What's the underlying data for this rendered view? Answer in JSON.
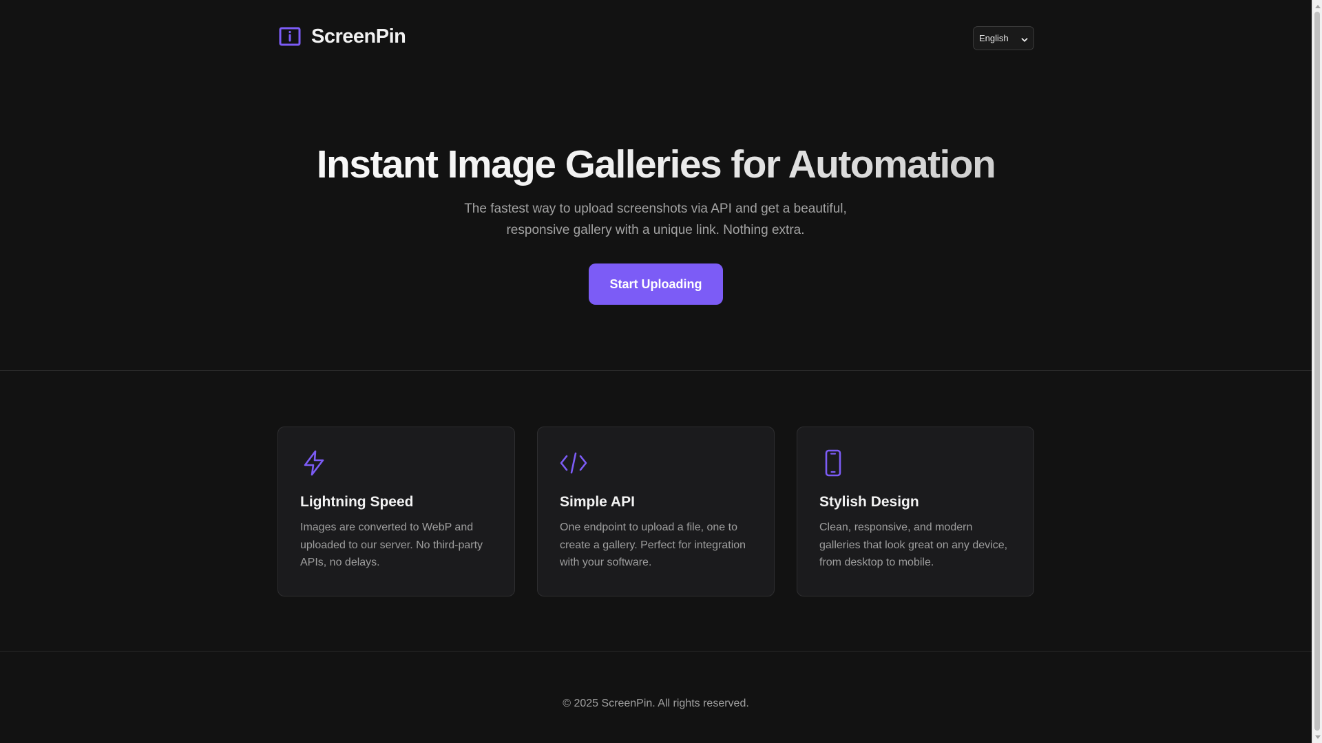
{
  "header": {
    "brand_name": "ScreenPin",
    "brand_icon": "info-panel-icon",
    "language": {
      "selected": "English",
      "icon": "chevron-down-icon"
    }
  },
  "hero": {
    "title": "Instant Image Galleries for Automation",
    "subtitle": "The fastest way to upload screenshots via API and get a beautiful, responsive gallery with a unique link. Nothing extra.",
    "cta_label": "Start Uploading"
  },
  "features": [
    {
      "icon": "lightning-icon",
      "title": "Lightning Speed",
      "text": "Images are converted to WebP and uploaded to our server. No third-party APIs, no delays."
    },
    {
      "icon": "code-icon",
      "title": "Simple API",
      "text": "One endpoint to upload a file, one to create a gallery. Perfect for integration with your software."
    },
    {
      "icon": "smartphone-icon",
      "title": "Stylish Design",
      "text": "Clean, responsive, and modern galleries that look great on any device, from desktop to mobile."
    }
  ],
  "footer": {
    "copyright": "© 2025 ScreenPin. All rights reserved."
  },
  "colors": {
    "background": "#121212",
    "accent": "#7c5cf6",
    "card_background": "#1b1b1d",
    "border": "#2a2a2a",
    "muted_text": "#a3a3a3"
  }
}
